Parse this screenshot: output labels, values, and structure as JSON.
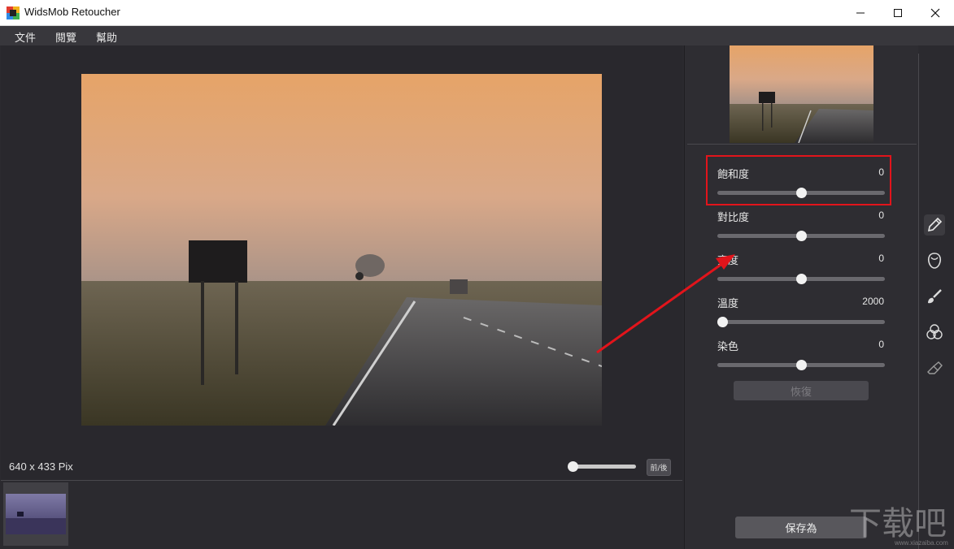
{
  "window": {
    "title": "WidsMob Retoucher",
    "controls": [
      "minimize-icon",
      "maximize-icon",
      "close-icon"
    ]
  },
  "menu": {
    "items": [
      "文件",
      "閱覽",
      "幫助"
    ]
  },
  "canvas": {
    "image_size": "640 x 433 Pix",
    "compare_label": "前/後",
    "zoom_level": 0.05
  },
  "adjustments": {
    "sliders": [
      {
        "label": "飽和度",
        "value": "0",
        "fraction": 0.5
      },
      {
        "label": "對比度",
        "value": "0",
        "fraction": 0.5
      },
      {
        "label": "亮度",
        "value": "0",
        "fraction": 0.5
      },
      {
        "label": "溫度",
        "value": "2000",
        "fraction": 0.03
      },
      {
        "label": "染色",
        "value": "0",
        "fraction": 0.5
      }
    ],
    "reset_label": "恢復",
    "save_label": "保存為"
  },
  "toolbar": {
    "tools": [
      "pencil-icon",
      "face-icon",
      "brush-icon",
      "color-circles-icon",
      "eraser-icon"
    ]
  },
  "watermark": {
    "text": "下载吧",
    "subtext": "www.xiazaiba.com"
  },
  "colors": {
    "accent_highlight": "#e2141b",
    "panel_background": "#2e2d32",
    "canvas_background": "#29282d"
  }
}
